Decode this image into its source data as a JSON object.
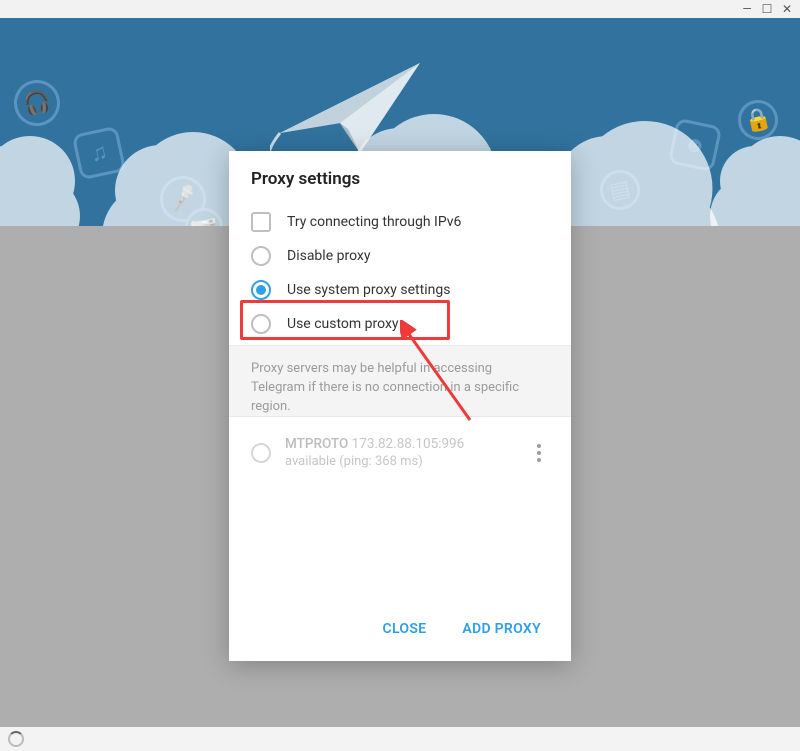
{
  "dialog": {
    "title": "Proxy settings",
    "options": {
      "ipv6": "Try connecting through IPv6",
      "disable": "Disable proxy",
      "system": "Use system proxy settings",
      "custom": "Use custom proxy"
    },
    "selected": "system",
    "hint": "Proxy servers may be helpful in accessing Telegram if there is no connection in a specific region.",
    "proxies": [
      {
        "protocol": "MTPROTO",
        "addr": "173.82.88.105:996",
        "status": "available (ping: 368 ms)"
      }
    ],
    "buttons": {
      "close": "CLOSE",
      "add": "ADD PROXY"
    }
  },
  "window_controls": {
    "min": "—",
    "max": "☐",
    "close": "✕"
  }
}
